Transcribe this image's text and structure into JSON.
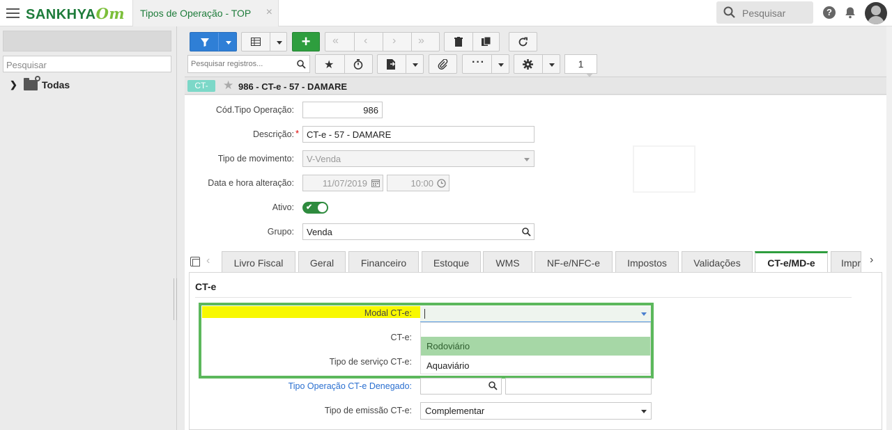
{
  "app": {
    "logo": "SANKHYA",
    "logo_suffix": "Om",
    "tab_title": "Tipos de Operação - TOP",
    "tab_close": "×",
    "search_placeholder": "Pesquisar"
  },
  "sidebar": {
    "search_placeholder": "Pesquisar",
    "tree_item": "Todas"
  },
  "toolbar": {
    "record_search_placeholder": "Pesquisar registros...",
    "page_number": "1"
  },
  "record": {
    "badge": "CT-",
    "title": "986 - CT-e - 57 - DAMARE"
  },
  "form": {
    "cod_label": "Cód.Tipo Operação:",
    "cod_value": "986",
    "descricao_label": "Descrição:",
    "descricao_value": "CT-e - 57 - DAMARE",
    "tipo_mov_label": "Tipo de movimento:",
    "tipo_mov_value": "V-Venda",
    "data_label": "Data e hora alteração:",
    "data_value": "11/07/2019",
    "hora_value": "10:00",
    "ativo_label": "Ativo:",
    "ativo_value": true,
    "grupo_label": "Grupo:",
    "grupo_value": "Venda"
  },
  "tabs": [
    {
      "label": "Livro Fiscal"
    },
    {
      "label": "Geral"
    },
    {
      "label": "Financeiro"
    },
    {
      "label": "Estoque"
    },
    {
      "label": "WMS"
    },
    {
      "label": "NF-e/NFC-e"
    },
    {
      "label": "Impostos"
    },
    {
      "label": "Validações"
    },
    {
      "label": "CT-e/MD-e"
    },
    {
      "label": "Impr"
    }
  ],
  "cte_panel": {
    "section_title": "CT-e",
    "modal_label": "Modal CT-e:",
    "modal_value": "",
    "modal_options": [
      "Rodoviário",
      "Aquaviário"
    ],
    "cte_label": "CT-e:",
    "tipo_servico_label": "Tipo de serviço CT-e:",
    "tipo_op_denegado_label": "Tipo Operação CT-e Denegado:",
    "tipo_emissao_label": "Tipo de emissão CT-e:",
    "tipo_emissao_value": "Complementar"
  }
}
